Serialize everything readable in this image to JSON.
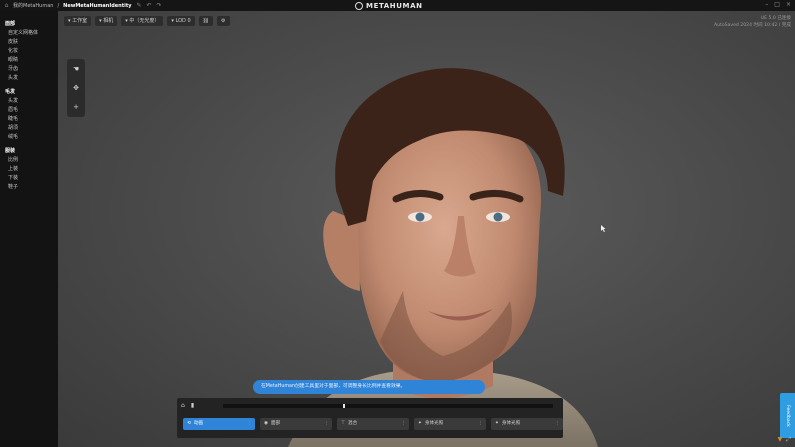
{
  "topbar": {
    "crumbs": [
      "我的MetaHuman",
      "NewMetaHumanIdentity"
    ],
    "brand": "METAHUMAN"
  },
  "sidebar": {
    "groups": [
      {
        "title": "面部",
        "items": [
          "自定义网格体",
          "皮肤",
          "化妆",
          "眼睛",
          "牙齿",
          "头发"
        ]
      },
      {
        "title": "毛发",
        "items": [
          "头发",
          "眉毛",
          "睫毛",
          "胡须",
          "绒毛"
        ]
      },
      {
        "title": "服装",
        "items": [
          "比例",
          "上装",
          "下装",
          "鞋子"
        ]
      }
    ]
  },
  "viewport": {
    "toolbar": [
      "工作室",
      "相机",
      "中（无光度）",
      "LOD 0"
    ],
    "info_lines": [
      "UE 5.0 已连接",
      "AutoSaved 2024 时间 10:42 / 完成"
    ]
  },
  "subtitle": "在MetaHuman创建工具里对于面部，可调整身长比例并查看效果。",
  "dock": {
    "tabs": [
      "动画",
      "面部",
      "混合",
      "身体光照",
      "身体光照"
    ]
  },
  "feedback_label": "Feedback",
  "colors": {
    "accent": "#2f84d8",
    "feedback": "#2f9de2"
  }
}
